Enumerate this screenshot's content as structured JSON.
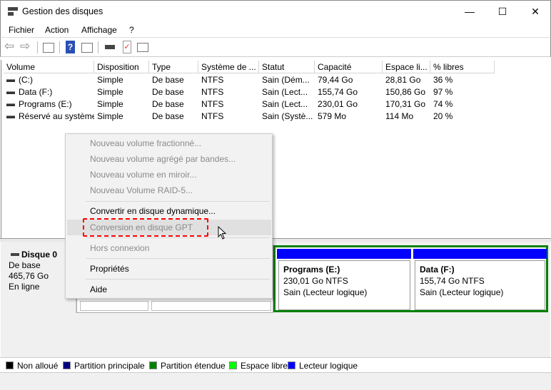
{
  "window": {
    "title": "Gestion des disques",
    "minimize": "—",
    "maximize": "☐",
    "close": "✕"
  },
  "menu": [
    "Fichier",
    "Action",
    "Affichage",
    "?"
  ],
  "toolbar": {
    "icons": [
      "back-arrow-icon",
      "forward-arrow-icon",
      "console-tree-icon",
      "help-icon",
      "action-pane-icon",
      "disk-icon",
      "check-icon",
      "properties-list-icon"
    ]
  },
  "table": {
    "headers": [
      "Volume",
      "Disposition",
      "Type",
      "Système de ...",
      "Statut",
      "Capacité",
      "Espace li...",
      "% libres"
    ],
    "rows": [
      [
        "(C:)",
        "Simple",
        "De base",
        "NTFS",
        "Sain (Dém...",
        "79,44 Go",
        "28,81 Go",
        "36 %"
      ],
      [
        "Data (F:)",
        "Simple",
        "De base",
        "NTFS",
        "Sain (Lect...",
        "155,74 Go",
        "150,86 Go",
        "97 %"
      ],
      [
        "Programs (E:)",
        "Simple",
        "De base",
        "NTFS",
        "Sain (Lect...",
        "230,01 Go",
        "170,31 Go",
        "74 %"
      ],
      [
        "Réservé au système",
        "Simple",
        "De base",
        "NTFS",
        "Sain (Systè...",
        "579 Mo",
        "114 Mo",
        "20 %"
      ]
    ]
  },
  "disk": {
    "name": "Disque 0",
    "type": "De base",
    "size": "465,76 Go",
    "state": "En ligne",
    "partitions": [
      {
        "name": "Programs  (E:)",
        "size": "230,01 Go NTFS",
        "status": "Sain (Lecteur logique)"
      },
      {
        "name": "Data  (F:)",
        "size": "155,74 Go NTFS",
        "status": "Sain (Lecteur logique)"
      }
    ]
  },
  "context_menu": {
    "items": [
      {
        "label": "Nouveau volume fractionné...",
        "enabled": false
      },
      {
        "label": "Nouveau volume agrégé par bandes...",
        "enabled": false
      },
      {
        "label": "Nouveau volume en miroir...",
        "enabled": false
      },
      {
        "label": "Nouveau Volume RAID-5...",
        "enabled": false
      },
      {
        "label": "Convertir en disque dynamique...",
        "enabled": true
      },
      {
        "label": "Conversion en disque GPT",
        "enabled": false,
        "highlighted": true
      },
      {
        "label": "Hors connexion",
        "enabled": false
      },
      {
        "label": "Propriétés",
        "enabled": true
      },
      {
        "label": "Aide",
        "enabled": true
      }
    ]
  },
  "legend": [
    {
      "label": "Non alloué",
      "color": "#000000"
    },
    {
      "label": "Partition principale",
      "color": "#000080"
    },
    {
      "label": "Partition étendue",
      "color": "#008000"
    },
    {
      "label": "Espace libre",
      "color": "#00ff00"
    },
    {
      "label": "Lecteur logique",
      "color": "#0000ff"
    }
  ]
}
